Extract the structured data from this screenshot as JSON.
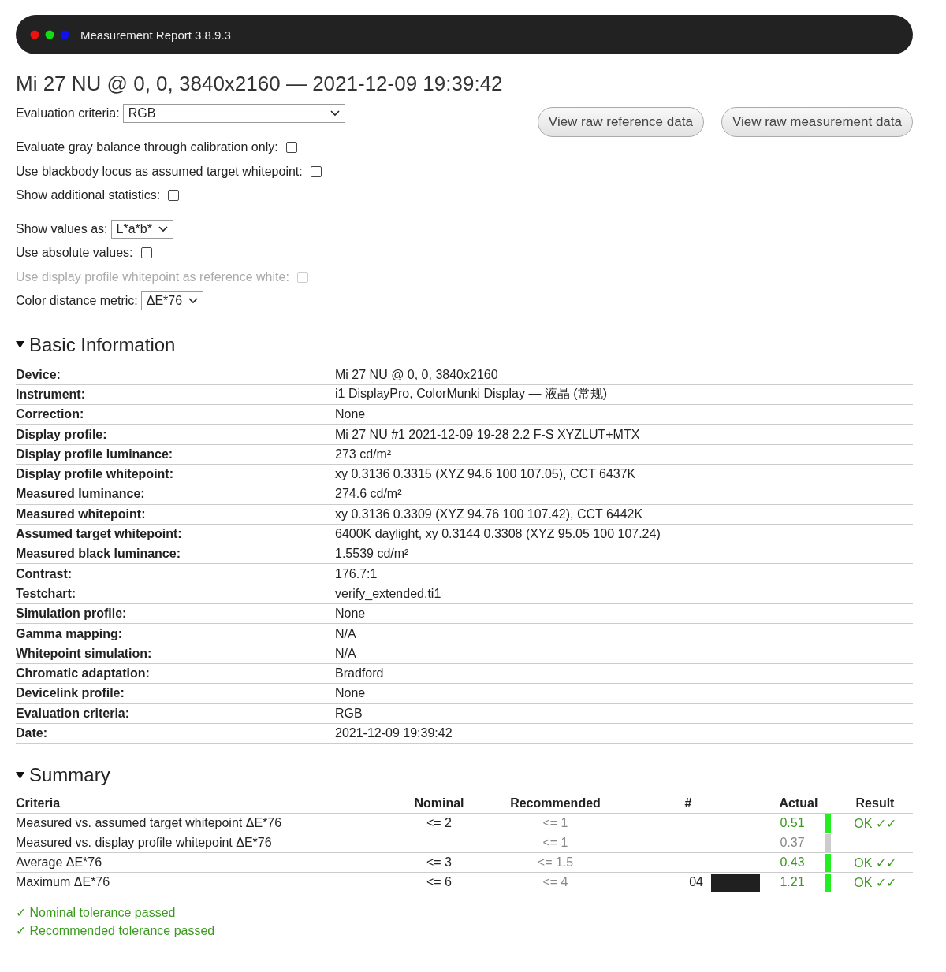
{
  "window": {
    "title": "Measurement Report 3.8.9.3"
  },
  "heading": "Mi 27 NU @ 0, 0, 3840x2160 — 2021-12-09 19:39:42",
  "evaluation_criteria": {
    "label": "Evaluation criteria:",
    "value": "RGB"
  },
  "buttons": [
    "View raw reference data",
    "View raw measurement data"
  ],
  "options": [
    {
      "kind": "checkbox",
      "label": "Evaluate gray balance through calibration only:",
      "checked": false,
      "disabled": false
    },
    {
      "kind": "checkbox",
      "label": "Use blackbody locus as assumed target whitepoint:",
      "checked": false,
      "disabled": false
    },
    {
      "kind": "checkbox",
      "label": "Show additional statistics:",
      "checked": false,
      "disabled": false
    },
    {
      "kind": "select",
      "label": "Show values as:",
      "value": "L*a*b*"
    },
    {
      "kind": "checkbox",
      "label": "Use absolute values:",
      "checked": false,
      "disabled": false
    },
    {
      "kind": "checkbox",
      "label": "Use display profile whitepoint as reference white:",
      "checked": false,
      "disabled": true
    },
    {
      "kind": "select",
      "label": "Color distance metric:",
      "value": "ΔE*76"
    }
  ],
  "basic_information": {
    "title": "Basic Information",
    "expanded": true,
    "rows": [
      {
        "label": "Device:",
        "value": "Mi 27 NU @ 0, 0, 3840x2160"
      },
      {
        "label": "Instrument:",
        "value": "i1 DisplayPro, ColorMunki Display — 液晶 (常规)"
      },
      {
        "label": "Correction:",
        "value": "None"
      },
      {
        "label": "Display profile:",
        "value": "Mi 27 NU #1 2021-12-09 19-28 2.2 F-S XYZLUT+MTX"
      },
      {
        "label": "Display profile luminance:",
        "value": "273 cd/m²"
      },
      {
        "label": "Display profile whitepoint:",
        "value": "xy 0.3136 0.3315 (XYZ 94.6 100 107.05), CCT 6437K"
      },
      {
        "label": "Measured luminance:",
        "value": "274.6 cd/m²"
      },
      {
        "label": "Measured whitepoint:",
        "value": "xy 0.3136 0.3309 (XYZ 94.76 100 107.42), CCT 6442K"
      },
      {
        "label": "Assumed target whitepoint:",
        "value": "6400K daylight, xy 0.3144 0.3308 (XYZ 95.05 100 107.24)"
      },
      {
        "label": "Measured black luminance:",
        "value": "1.5539 cd/m²"
      },
      {
        "label": "Contrast:",
        "value": "176.7:1"
      },
      {
        "label": "Testchart:",
        "value": "verify_extended.ti1"
      },
      {
        "label": "Simulation profile:",
        "value": "None"
      },
      {
        "label": "Gamma mapping:",
        "value": "N/A"
      },
      {
        "label": "Whitepoint simulation:",
        "value": "N/A"
      },
      {
        "label": "Chromatic adaptation:",
        "value": "Bradford"
      },
      {
        "label": "Devicelink profile:",
        "value": "None"
      },
      {
        "label": "Evaluation criteria:",
        "value": "RGB"
      },
      {
        "label": "Date:",
        "value": "2021-12-09 19:39:42"
      }
    ]
  },
  "summary": {
    "title": "Summary",
    "expanded": true,
    "columns": [
      "Criteria",
      "Nominal",
      "Recommended",
      "#",
      "Actual",
      "Result"
    ],
    "rows": [
      {
        "criteria": "Measured vs. assumed target whitepoint ΔE*76",
        "nominal": "<= 2",
        "recommended": "<= 1",
        "actual": "0.51",
        "passed": true,
        "result": "OK ✓✓"
      },
      {
        "criteria": "Measured vs. display profile whitepoint ΔE*76",
        "recommended": "<= 1",
        "actual": "0.37",
        "passed": false
      },
      {
        "criteria": "Average ΔE*76",
        "nominal": "<= 3",
        "recommended": "<= 1.5",
        "actual": "0.43",
        "passed": true,
        "result": "OK ✓✓"
      },
      {
        "criteria": "Maximum ΔE*76",
        "nominal": "<= 6",
        "recommended": "<= 4",
        "number": "04",
        "color": "#202020",
        "actual": "1.21",
        "passed": true,
        "result": "OK ✓✓"
      }
    ],
    "notes": [
      "✓ Nominal tolerance passed",
      "✓ Recommended tolerance passed"
    ]
  }
}
